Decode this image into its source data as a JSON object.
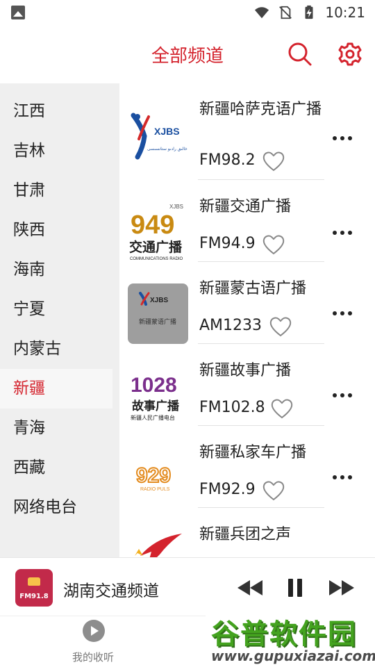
{
  "status_bar": {
    "time": "10:21"
  },
  "header": {
    "title": "全部频道"
  },
  "sidebar": {
    "items": [
      "江西",
      "吉林",
      "甘肃",
      "陕西",
      "海南",
      "宁夏",
      "内蒙古",
      "新疆",
      "青海",
      "西藏",
      "网络电台"
    ],
    "active_index": 7
  },
  "stations": [
    {
      "name": "新疆哈萨克语广播",
      "freq": "FM98.2",
      "logo_text": "XJBS",
      "logo_sub": "شىنجاڭ خالىق رادىو ستانسىسى"
    },
    {
      "name": "新疆交通广播",
      "freq": "FM94.9",
      "logo_text": "949",
      "logo_top": "XJBS",
      "logo_sub": "交通广播",
      "logo_foot": "COMMUNICATIONS RADIO"
    },
    {
      "name": "新疆蒙古语广播",
      "freq": "AM1233",
      "logo_text": "XJBS",
      "logo_sub": "新疆蒙语广播"
    },
    {
      "name": "新疆故事广播",
      "freq": "FM102.8",
      "logo_text": "1028",
      "logo_sub": "故事广播",
      "logo_foot": "新疆人民广播电台"
    },
    {
      "name": "新疆私家车广播",
      "freq": "FM92.9",
      "logo_text": "929",
      "logo_sub": "RADIO PULS"
    },
    {
      "name": "新疆兵团之声",
      "freq": "",
      "logo_text": ""
    }
  ],
  "player": {
    "station": "湖南交通频道",
    "cover_text": "FM91.8"
  },
  "tabbar": {
    "tabs": [
      {
        "label": "我的收听",
        "icon": "play-circle-icon"
      }
    ]
  },
  "watermark": {
    "top": "谷普软件园",
    "bottom": "www.gupuxiazai.com"
  },
  "colors": {
    "accent": "#d4232d",
    "sidebar_bg": "#efefef",
    "watermark_green": "#44a31f"
  }
}
